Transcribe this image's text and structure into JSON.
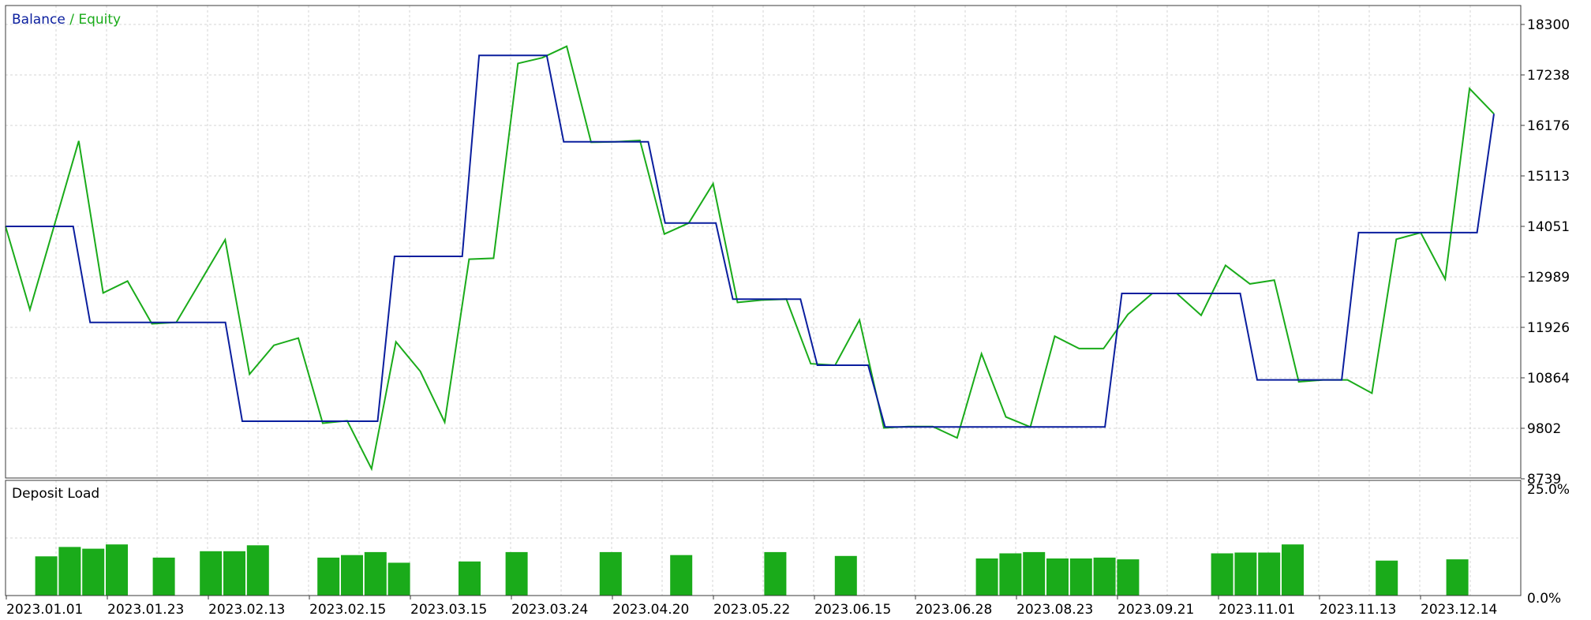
{
  "chart_data": [
    {
      "type": "line",
      "title": "",
      "legend": [
        "Balance",
        "Equity"
      ],
      "legend_separator": "/",
      "legend_placement": "top-left",
      "grid": true,
      "ylim": [
        8739,
        18300
      ],
      "y_ticks": [
        18300,
        17238,
        16176,
        15113,
        14051,
        12989,
        11926,
        10864,
        9802,
        8739
      ],
      "series": [
        {
          "name": "Balance",
          "color": "#0a1e9e",
          "points": [
            [
              0,
              14051
            ],
            [
              4,
              14051
            ],
            [
              5,
              12030
            ],
            [
              13,
              12030
            ],
            [
              14,
              9950
            ],
            [
              22,
              9950
            ],
            [
              23,
              13420
            ],
            [
              27,
              13420
            ],
            [
              28,
              17650
            ],
            [
              32,
              17650
            ],
            [
              33,
              15830
            ],
            [
              38,
              15830
            ],
            [
              39,
              14120
            ],
            [
              42,
              14120
            ],
            [
              43,
              12520
            ],
            [
              47,
              12520
            ],
            [
              48,
              11130
            ],
            [
              51,
              11130
            ],
            [
              52,
              9830
            ],
            [
              65,
              9830
            ],
            [
              66,
              12640
            ],
            [
              73,
              12640
            ],
            [
              74,
              10820
            ],
            [
              79,
              10820
            ],
            [
              80,
              13920
            ],
            [
              87,
              13920
            ],
            [
              88,
              16420
            ]
          ]
        },
        {
          "name": "Equity",
          "color": "#1aab1a",
          "points": [
            [
              0,
              14051
            ],
            [
              1,
              12300
            ],
            [
              3,
              15850
            ],
            [
              4,
              12650
            ],
            [
              5,
              12900
            ],
            [
              6,
              12000
            ],
            [
              7,
              12030
            ],
            [
              9,
              13770
            ],
            [
              10,
              10940
            ],
            [
              11,
              11550
            ],
            [
              12,
              11700
            ],
            [
              13,
              9910
            ],
            [
              14,
              9960
            ],
            [
              15,
              8950
            ],
            [
              16,
              11620
            ],
            [
              17,
              11000
            ],
            [
              18,
              9930
            ],
            [
              19,
              13360
            ],
            [
              20,
              13380
            ],
            [
              21,
              17480
            ],
            [
              22,
              17600
            ],
            [
              23,
              17840
            ],
            [
              24,
              15820
            ],
            [
              25,
              15830
            ],
            [
              26,
              15860
            ],
            [
              27,
              13890
            ],
            [
              28,
              14120
            ],
            [
              29,
              14950
            ],
            [
              30,
              12450
            ],
            [
              31,
              12500
            ],
            [
              32,
              12520
            ],
            [
              33,
              11160
            ],
            [
              34,
              11130
            ],
            [
              35,
              12080
            ],
            [
              36,
              9810
            ],
            [
              37,
              9840
            ],
            [
              38,
              9840
            ],
            [
              39,
              9600
            ],
            [
              40,
              11370
            ],
            [
              41,
              10040
            ],
            [
              42,
              9830
            ],
            [
              43,
              11740
            ],
            [
              44,
              11480
            ],
            [
              45,
              11480
            ],
            [
              46,
              12200
            ],
            [
              47,
              12640
            ],
            [
              48,
              12640
            ],
            [
              49,
              12180
            ],
            [
              50,
              13230
            ],
            [
              51,
              12840
            ],
            [
              52,
              12920
            ],
            [
              53,
              10780
            ],
            [
              54,
              10820
            ],
            [
              55,
              10820
            ],
            [
              56,
              10540
            ],
            [
              57,
              13780
            ],
            [
              58,
              13920
            ],
            [
              59,
              12940
            ],
            [
              60,
              16950
            ],
            [
              61,
              16420
            ]
          ]
        }
      ]
    },
    {
      "type": "bar",
      "title": "Deposit Load",
      "ylim": [
        0,
        25
      ],
      "y_ticks": [
        "25.0%",
        "0.0%"
      ],
      "color": "#1aab1a",
      "x_tick_labels": [
        "2023.01.01",
        "2023.01.23",
        "2023.02.13",
        "2023.02.15",
        "2023.03.15",
        "2023.03.24",
        "2023.04.20",
        "2023.05.22",
        "2023.06.15",
        "2023.06.28",
        "2023.08.23",
        "2023.09.21",
        "2023.11.01",
        "2023.11.13",
        "2023.12.14"
      ],
      "bars": [
        {
          "slot": 2,
          "value": 9.2
        },
        {
          "slot": 3,
          "value": 11.4
        },
        {
          "slot": 4,
          "value": 11.0
        },
        {
          "slot": 5,
          "value": 12.0
        },
        {
          "slot": 7,
          "value": 8.9
        },
        {
          "slot": 9,
          "value": 10.4
        },
        {
          "slot": 10,
          "value": 10.4
        },
        {
          "slot": 11,
          "value": 11.8
        },
        {
          "slot": 14,
          "value": 8.9
        },
        {
          "slot": 15,
          "value": 9.5
        },
        {
          "slot": 16,
          "value": 10.2
        },
        {
          "slot": 17,
          "value": 7.7
        },
        {
          "slot": 20,
          "value": 8.0
        },
        {
          "slot": 22,
          "value": 10.2
        },
        {
          "slot": 26,
          "value": 10.2
        },
        {
          "slot": 29,
          "value": 9.5
        },
        {
          "slot": 33,
          "value": 10.2
        },
        {
          "slot": 36,
          "value": 9.3
        },
        {
          "slot": 42,
          "value": 8.7
        },
        {
          "slot": 43,
          "value": 9.9
        },
        {
          "slot": 44,
          "value": 10.2
        },
        {
          "slot": 45,
          "value": 8.7
        },
        {
          "slot": 46,
          "value": 8.7
        },
        {
          "slot": 47,
          "value": 8.9
        },
        {
          "slot": 48,
          "value": 8.5
        },
        {
          "slot": 52,
          "value": 9.9
        },
        {
          "slot": 53,
          "value": 10.1
        },
        {
          "slot": 54,
          "value": 10.1
        },
        {
          "slot": 55,
          "value": 12.0
        },
        {
          "slot": 59,
          "value": 8.2
        },
        {
          "slot": 62,
          "value": 8.5
        }
      ]
    }
  ]
}
